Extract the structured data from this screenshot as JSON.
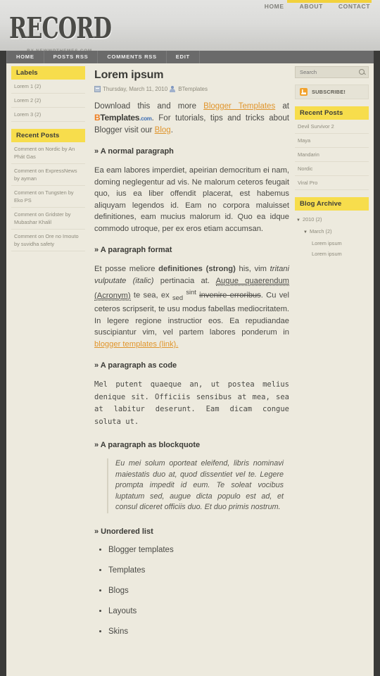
{
  "topnav": {
    "items": [
      {
        "label": "HOME"
      },
      {
        "label": "ABOUT"
      },
      {
        "label": "CONTACT"
      }
    ]
  },
  "logo": {
    "word": "RECORD",
    "sub": "BY NEWWPTHEMES.COM"
  },
  "mainnav": {
    "items": [
      {
        "label": "HOME"
      },
      {
        "label": "POSTS RSS"
      },
      {
        "label": "COMMENTS RSS"
      },
      {
        "label": "EDIT"
      }
    ]
  },
  "sidebar_left": {
    "labels": {
      "title": "Labels",
      "items": [
        {
          "label": "Lorem 1 (2)"
        },
        {
          "label": "Lorem 2 (2)"
        },
        {
          "label": "Lorem 3 (2)"
        }
      ]
    },
    "recent": {
      "title": "Recent Posts",
      "items": [
        {
          "label": "Comment on Nordic by An Phát Gas"
        },
        {
          "label": "Comment on ExpressNews by ayman"
        },
        {
          "label": "Comment on Tungsten by Eko PS"
        },
        {
          "label": "Comment on Gridster by Mubashar Khalil"
        },
        {
          "label": "Comment on Ore no Imouto by suvidha safety"
        }
      ]
    }
  },
  "post": {
    "title": "Lorem ipsum",
    "date": "Thursday, March 11, 2010",
    "author": "BTemplates",
    "intro_1": "Download this and more ",
    "intro_link_1": "Blogger Templates",
    "intro_2": " at ",
    "brand_b": "B",
    "brand_t": "Templates",
    "brand_c": ".com",
    "intro_3": ". For tutorials, tips and tricks about Blogger visit our ",
    "intro_link_2": "Blog",
    "intro_4": ".",
    "sec_normal": "» A normal paragraph",
    "p_normal": "Ea eam labores imperdiet, apeirian democritum ei nam, doming neglegentur ad vis. Ne malorum ceteros feugait quo, ius ea liber offendit placerat, est habemus aliquyam legendos id. Eam no corpora maluisset definitiones, eam mucius malorum id. Quo ea idque commodo utroque, per ex eros etiam accumsan.",
    "sec_format": "» A paragraph format",
    "f_1": "Et posse meliore ",
    "f_strong": "definitiones (strong)",
    "f_2": " his, vim ",
    "f_italic": "tritani vulputate (italic)",
    "f_3": " pertinacia at. ",
    "f_underline": "Augue quaerendum (Acronym)",
    "f_4": " te sea, ex ",
    "f_sub": "sed",
    "f_sup": "sint",
    "f_strike": "invenire erroribus",
    "f_5": ". Cu vel ceteros scripserit, te usu modus fabellas mediocritatem. In legere regione instructior eos. Ea repudiandae suscipiantur vim, vel partem labores ponderum in ",
    "f_link": "blogger templates (link).",
    "sec_code": "» A paragraph as code",
    "code": "Mel putent quaeque an, ut postea melius denique sit. Officiis sensibus at mea, sea at labitur deserunt. Eam dicam congue soluta ut.",
    "sec_quote": "» A paragraph as blockquote",
    "quote": "Eu mei solum oporteat eleifend, libris nominavi maiestatis duo at, quod dissentiet vel te. Legere prompta impedit id eum. Te soleat vocibus luptatum sed, augue dicta populo est ad, et consul diceret officiis duo. Et duo primis nostrum.",
    "sec_list": "» Unordered list",
    "list": [
      {
        "label": "Blogger templates"
      },
      {
        "label": "Templates"
      },
      {
        "label": "Blogs"
      },
      {
        "label": "Layouts"
      },
      {
        "label": "Skins"
      }
    ]
  },
  "sidebar_right": {
    "search": {
      "placeholder": "Search",
      "value": ""
    },
    "subscribe": {
      "label": "SUBSCRIBE!"
    },
    "recent": {
      "title": "Recent Posts",
      "items": [
        {
          "label": "Devil Survivor 2"
        },
        {
          "label": "Maya"
        },
        {
          "label": "Mandarin"
        },
        {
          "label": "Nordic"
        },
        {
          "label": "Viral Pro"
        }
      ]
    },
    "archive": {
      "title": "Blog Archive",
      "year": "2010 (2)",
      "month": "March (2)",
      "posts": [
        {
          "label": "Lorem ipsum"
        },
        {
          "label": "Lorem ipsum"
        }
      ],
      "triangle": "▼"
    }
  },
  "colors": {
    "accent": "#f7dd4c",
    "link": "#e0952c",
    "nav_bg": "#6a6a6a",
    "page_bg": "#edeade"
  }
}
